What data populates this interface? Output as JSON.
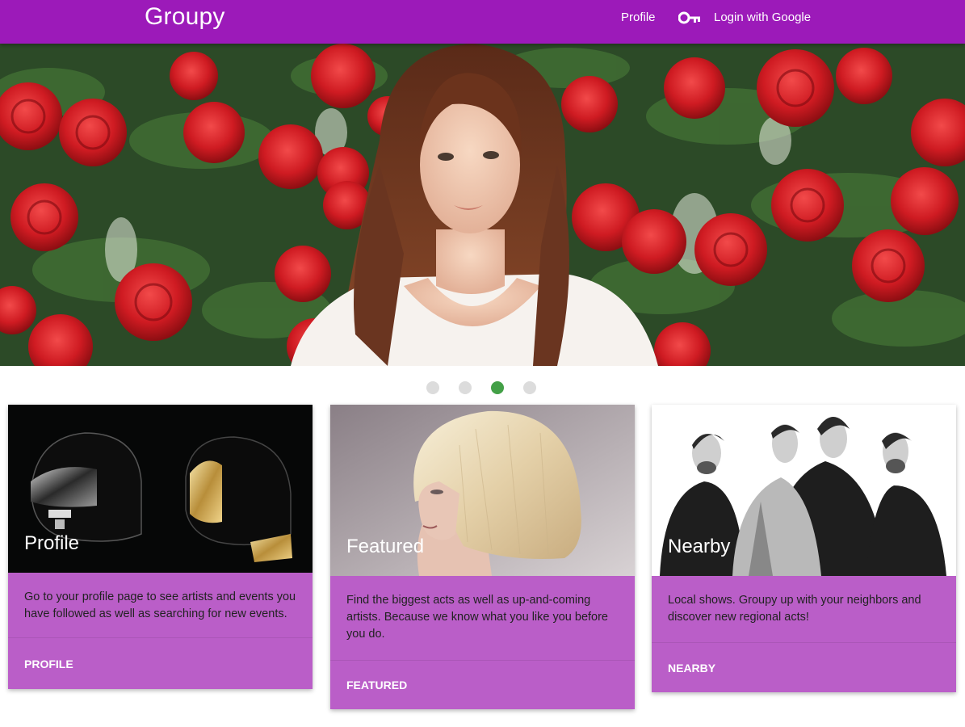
{
  "navbar": {
    "brand": "Groupy",
    "links": {
      "profile": "Profile",
      "login": "Login with Google"
    },
    "background": "#9c1ab9"
  },
  "icons": {
    "login": "key-icon"
  },
  "carousel": {
    "slide_count": 4,
    "active_index": 2,
    "active_color": "#43a047",
    "inactive_color": "#dcdcdc"
  },
  "cards": [
    {
      "title": "Profile",
      "description": "Go to your profile page to see artists and events you have followed as well as searching for new events.",
      "action": "PROFILE"
    },
    {
      "title": "Featured",
      "description": "Find the biggest acts as well as up-and-coming artists. Because we know what you like you before you do.",
      "action": "FEATURED"
    },
    {
      "title": "Nearby",
      "description": "Local shows. Groupy up with your neighbors and discover new regional acts!",
      "action": "NEARBY"
    }
  ],
  "colors": {
    "card_background": "#ba5ec8"
  }
}
